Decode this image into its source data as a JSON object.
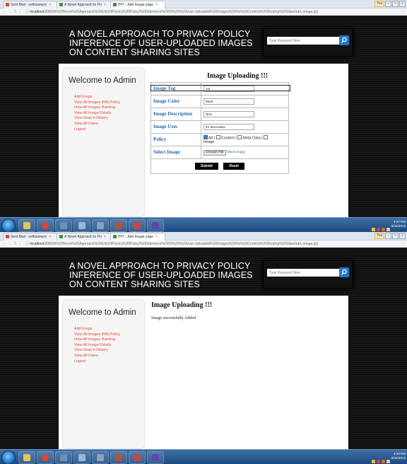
{
  "shots": [
    {
      "browser": {
        "tabs": [
          {
            "label": "Sent Mail - softwarepro",
            "favicon_color": "#d54b3d"
          },
          {
            "label": "A Novel Approach to Pri",
            "favicon_color": "#4a8a3c"
          },
          {
            "label": "PPI :: Add Image page",
            "favicon_color": "#4a8a3c"
          }
        ],
        "window_label": "You",
        "url_host": "localhost",
        "url_path": ":8080/A%20Novel%20Approach%20to%20Privacy%20Policy%20Inference%20Of%20%20User-Uploaded%20Images%20On%20Content%20Sharing%20Sites/add_image.jsp"
      },
      "site_title": "A NOVEL APPROACH TO PRIVACY POLICY INFERENCE OF USER-UPLOADED IMAGES ON CONTENT SHARING SITES",
      "search_placeholder": "Type Keyword Here",
      "sidebar": {
        "heading": "Welcome to Admin",
        "items": [
          "Add Image",
          "View All Images With Policy",
          "View All Images Ranking",
          "View All Image Details",
          "View Search History",
          "View All Users",
          "Logout"
        ]
      },
      "form": {
        "title": "Image Uploading !!!",
        "image_tag_label": "Image Tag",
        "image_tag_value": "cat",
        "image_color_label": "Image Color",
        "image_color_value": "black",
        "image_description_label": "Image Description",
        "image_description_value": "Nice",
        "image_uses_label": "Image Uses",
        "image_uses_value": "for decoration",
        "policy_label": "Policy",
        "policy_all": "All",
        "policy_content": "Content",
        "policy_meta": "Meta Data",
        "policy_image": "Image",
        "select_image_label": "Select Image",
        "choose_file_label": "Choose File",
        "file_name": "blackcat.jpg",
        "submit_label": "Submit",
        "reset_label": "Reset"
      },
      "clock": {
        "time": "4:27 PM",
        "date": "5/26/2016"
      }
    },
    {
      "browser": {
        "tabs": [
          {
            "label": "Sent Mail - softwarepro",
            "favicon_color": "#d54b3d"
          },
          {
            "label": "A Novel Approach to Pri",
            "favicon_color": "#4a8a3c"
          },
          {
            "label": "PPI :: Add Image page",
            "favicon_color": "#4a8a3c"
          }
        ],
        "window_label": "You",
        "url_host": "localhost",
        "url_path": ":8080/A%20Novel%20Approach%20to%20Privacy%20Policy%20Inference%20Of%20%20User-Uploaded%20Images%20On%20Content%20Sharing%20Sites/add_image.jsp"
      },
      "site_title": "A NOVEL APPROACH TO PRIVACY POLICY INFERENCE OF USER-UPLOADED IMAGES ON CONTENT SHARING SITES",
      "search_placeholder": "Type Keyword Here",
      "sidebar": {
        "heading": "Welcome to Admin",
        "items": [
          "Add Image",
          "View All Images With Policy",
          "View All Images Ranking",
          "View All Image Details",
          "View Search History",
          "View All Users",
          "Logout"
        ]
      },
      "result": {
        "title": "Image Uploading !!!",
        "message": "Image successfully Added"
      },
      "clock": {
        "time": "4:28 PM",
        "date": "5/26/2016"
      }
    }
  ],
  "colors": {
    "menu_link": "#e04a3a",
    "form_label": "#2d67a8",
    "search_button": "#2178c8"
  }
}
